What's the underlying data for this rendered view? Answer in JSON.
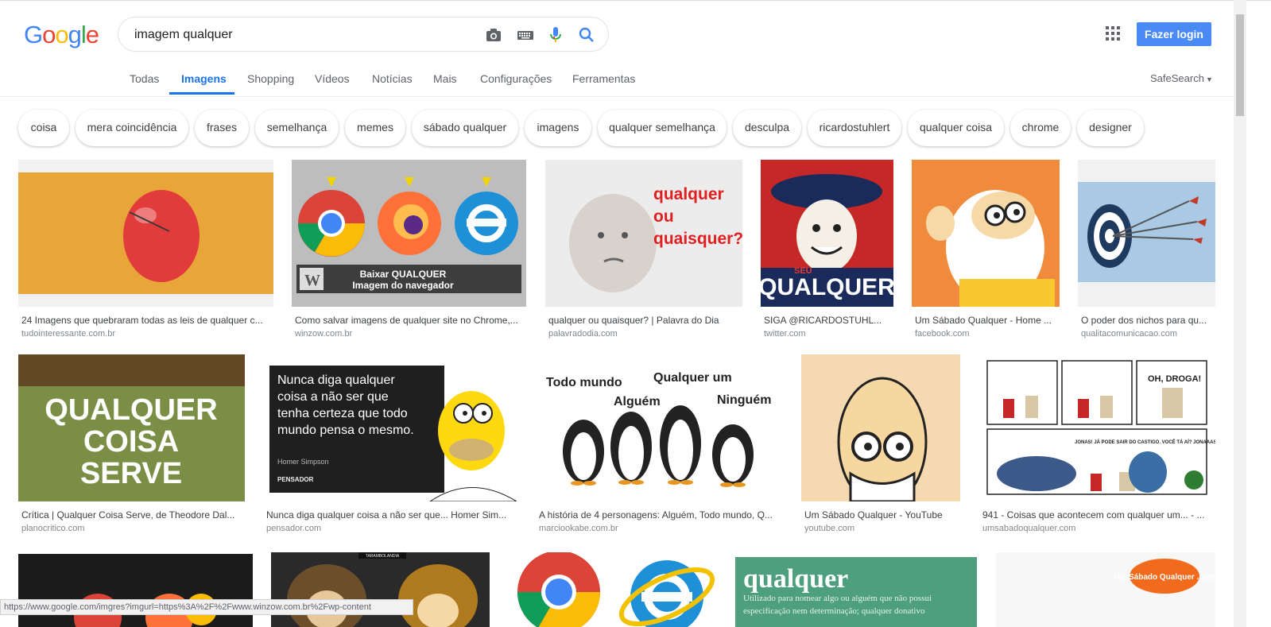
{
  "logo": {
    "letters": [
      "G",
      "o",
      "o",
      "g",
      "l",
      "e"
    ],
    "colors": [
      "#4285f4",
      "#ea4335",
      "#fbbc05",
      "#4285f4",
      "#34a853",
      "#ea4335"
    ]
  },
  "search": {
    "query": "imagem qualquer",
    "icons": [
      "camera-icon",
      "keyboard-icon",
      "mic-icon",
      "search-icon"
    ]
  },
  "header": {
    "login_label": "Fazer login"
  },
  "tabs": [
    {
      "label": "Todas"
    },
    {
      "label": "Imagens"
    },
    {
      "label": "Shopping"
    },
    {
      "label": "Vídeos"
    },
    {
      "label": "Notícias"
    },
    {
      "label": "Mais"
    },
    {
      "label": "Configurações"
    },
    {
      "label": "Ferramentas"
    }
  ],
  "safesearch": "SafeSearch",
  "chips": [
    "coisa",
    "mera coincidência",
    "frases",
    "semelhança",
    "memes",
    "sábado qualquer",
    "imagens",
    "qualquer semelhança",
    "desculpa",
    "ricardostuhlert",
    "qualquer coisa",
    "chrome",
    "designer"
  ],
  "results": [
    {
      "caption": "24 Imagens que quebraram todas as leis de qualquer c...",
      "source": "tudointeressante.com.br"
    },
    {
      "caption": "Como salvar imagens de qualquer site no Chrome,...",
      "source": "winzow.com.br",
      "text1": "Baixar QUALQUER",
      "text2": "Imagem do navegador"
    },
    {
      "caption": "qualquer ou quaisquer? | Palavra do Dia",
      "source": "palavradodia.com",
      "text1": "qualquer",
      "text2": "ou",
      "text3": "quaisquer?"
    },
    {
      "caption": "SIGA @RICARDOSTUHL...",
      "source": "twitter.com",
      "text1": "QUALQUER",
      "text2": "SEU"
    },
    {
      "caption": "Um Sábado Qualquer - Home ...",
      "source": "facebook.com"
    },
    {
      "caption": "O poder dos nichos para qu...",
      "source": "qualitacomunicacao.com"
    },
    {
      "caption": "Crítica | Qualquer Coisa Serve, de Theodore Dal...",
      "source": "planocritico.com",
      "text1": "QUALQUER",
      "text2": "COISA",
      "text3": "SERVE"
    },
    {
      "caption": "Nunca diga qualquer coisa a não ser que... Homer Sim...",
      "source": "pensador.com",
      "text1": "Nunca diga qualquer coisa a não ser que tenha certeza que todo mundo pensa o mesmo.",
      "text2": "Homer Simpson",
      "text3": "PENSADOR"
    },
    {
      "caption": "A história de 4 personagens: Alguém, Todo mundo, Q...",
      "source": "marciookabe.com.br",
      "text1": "Todo mundo",
      "text2": "Qualquer um",
      "text3": "Alguém",
      "text4": "Ninguém"
    },
    {
      "caption": "Um Sábado Qualquer - YouTube",
      "source": "youtube.com"
    },
    {
      "caption": "941 - Coisas que acontecem com qualquer um... - ...",
      "source": "umsabadoqualquer.com",
      "text1": "OH, DROGA!",
      "text2": "JONAS! JÁ PODE SAIR DO CASTIGO. VOCÊ TÁ AÍ? JONAAAS!"
    },
    {
      "text1": ""
    },
    {
      "text1": "TARAMBOLANDIA"
    },
    {
      "text1": ""
    },
    {
      "text1": "qualquer",
      "text2": "Utilizado para nomear algo ou alguém que não possui especificação nem determinação; qualquer donativo"
    },
    {
      "text1": "Um Sábado Qualquer .com"
    }
  ],
  "status_url": "https://www.google.com/imgres?imgurl=https%3A%2F%2Fwww.winzow.com.br%2Fwp-content"
}
